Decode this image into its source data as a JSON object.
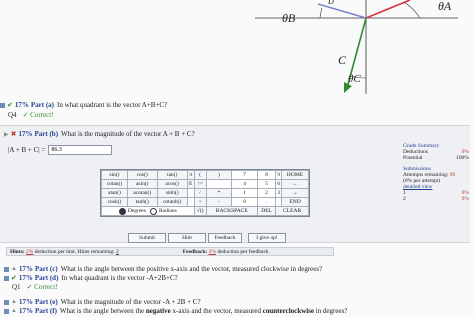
{
  "diagram": {
    "labels": {
      "theta_b": "θB",
      "theta_a": "θA",
      "vector_c": "C",
      "theta_c": "θC",
      "top_d": "D"
    },
    "colors": {
      "vector_a": "#d8333f",
      "vector_b": "#7a86c8",
      "vector_c": "#2e8b2e"
    }
  },
  "part_a": {
    "pct": "17%",
    "label": "Part (a)",
    "question": "In what quadrant is the vector A+B+C?",
    "answer_prefix": "Q4",
    "correct": "✓ Correct!"
  },
  "part_b": {
    "pct": "17%",
    "label": "Part (b)",
    "question": "What is the magnitude of the vector A + B + C?",
    "input_label": "|A + B + C| =",
    "input_value": "86.3",
    "calculator": {
      "rows": [
        [
          "sin()",
          "cos()",
          "tan()",
          "π",
          "(",
          ")",
          "7",
          "8",
          "9",
          "HOME"
        ],
        [
          "cotan()",
          "asin()",
          "acos()",
          "E",
          "↑^",
          "",
          "4",
          "5",
          "6",
          "←"
        ],
        [
          "atan()",
          "acotan()",
          "sinh()",
          "",
          "/",
          "*",
          "1",
          "2",
          "3",
          "→"
        ],
        [
          "cosh()",
          "tanh()",
          "cotanh()",
          "",
          "+",
          "-",
          "0",
          ".",
          "",
          "END"
        ]
      ],
      "last_row": [
        "√()",
        "BACKSPACE",
        "DEL",
        "CLEAR"
      ],
      "degrees": "Degrees",
      "radians": "Radians"
    },
    "buttons": {
      "submit": "Submit",
      "hint": "Hint",
      "feedback": "Feedback",
      "giveup": "I give up!"
    },
    "hints": {
      "prefix": "Hints:",
      "pct": "2%",
      "text": "deduction per hint. Hints remaining:",
      "remaining": "2"
    },
    "feedback": {
      "prefix": "Feedback:",
      "pct": "2%",
      "text": "deduction per feedback"
    }
  },
  "grade": {
    "title": "Grade Summary",
    "deductions_label": "Deductions",
    "deductions_value": "0%",
    "potential_label": "Potential",
    "potential_value": "100%",
    "submissions_label": "Submissions",
    "attempts_text": "Attempts remaining:",
    "attempts_value": "99",
    "per_attempt": "(0% per attempt)",
    "detailed_view": "detailed view",
    "rows": [
      {
        "n": "1",
        "v": "0%"
      },
      {
        "n": "2",
        "v": "0%"
      }
    ]
  },
  "part_c": {
    "pct": "17%",
    "label": "Part (c)",
    "question": "What is the angle between the positive x-axis and the vector, measured clockwise in degrees?"
  },
  "part_d": {
    "pct": "17%",
    "label": "Part (d)",
    "question": "In what quadrant is the vector -A+2B+C?",
    "answer_prefix": "Q1",
    "correct": "✓ Correct!"
  },
  "part_e": {
    "pct": "17%",
    "label": "Part (e)",
    "question": "What is the magnitude of the vector -A + 2B + C?"
  },
  "part_f": {
    "pct": "17%",
    "label": "Part (f)",
    "question_pre": "What is the angle between the",
    "question_bold": "negative",
    "question_post": "x-axis and the vector, measured",
    "question_bold2": "counterclockwise",
    "question_end": "in degrees?"
  }
}
